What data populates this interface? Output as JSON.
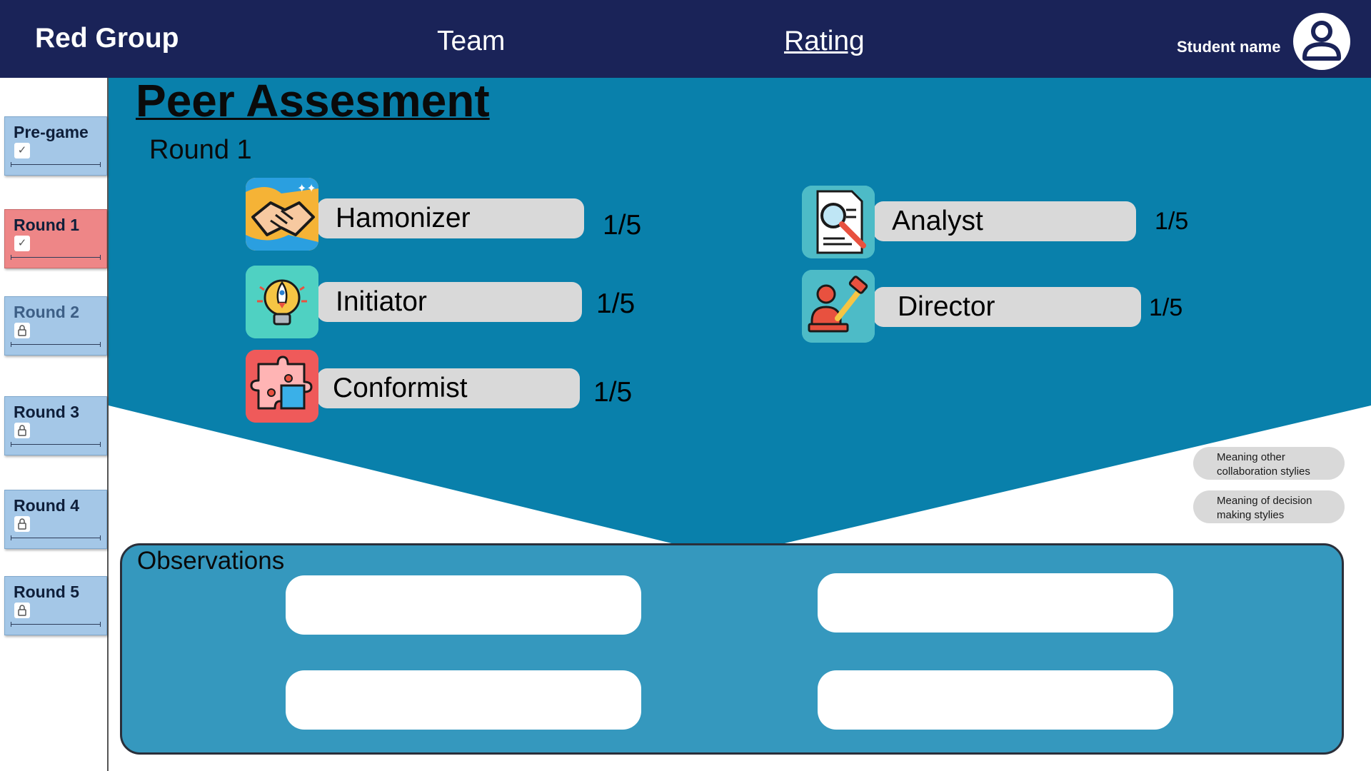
{
  "header": {
    "brand": "Red Group",
    "nav_team": "Team",
    "nav_rating": "Rating",
    "student_name": "Student name"
  },
  "sidebar": {
    "items": [
      {
        "label": "Pre-game",
        "state": "done",
        "icon": "check-icon"
      },
      {
        "label": "Round 1",
        "state": "active",
        "icon": "check-icon"
      },
      {
        "label": "Round 2",
        "state": "locked",
        "icon": "lock-icon"
      },
      {
        "label": "Round 3",
        "state": "locked",
        "icon": "lock-icon"
      },
      {
        "label": "Round 4",
        "state": "locked",
        "icon": "lock-icon"
      },
      {
        "label": "Round 5",
        "state": "locked",
        "icon": "lock-icon"
      }
    ]
  },
  "main": {
    "title": "Peer Assesment",
    "round": "Round 1",
    "roles": [
      {
        "name": "Hamonizer",
        "score": "1/5",
        "icon": "handshake-icon"
      },
      {
        "name": "Initiator",
        "score": "1/5",
        "icon": "lightbulb-rocket-icon"
      },
      {
        "name": "Conformist",
        "score": "1/5",
        "icon": "puzzle-icon"
      },
      {
        "name": "Analyst",
        "score": "1/5",
        "icon": "magnifier-document-icon"
      },
      {
        "name": "Director",
        "score": "1/5",
        "icon": "gavel-person-icon"
      }
    ],
    "info_buttons": [
      "Meaning other collaboration stylies",
      "Meaning of decision making stylies"
    ],
    "observations_title": "Observations"
  },
  "colors": {
    "header": "#1a2358",
    "main_blue": "#0980ab",
    "panel_blue": "#3598be",
    "active_tab": "#ee8687",
    "tab": "#a4c7e7"
  }
}
